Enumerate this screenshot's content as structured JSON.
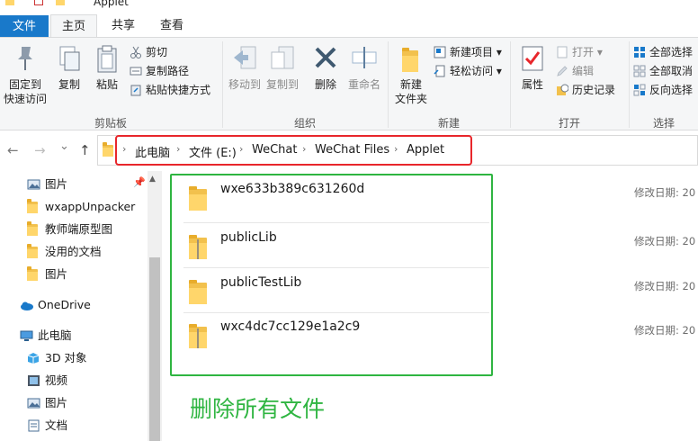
{
  "window": {
    "title": "Applet"
  },
  "tabs": {
    "file": "文件",
    "home": "主页",
    "share": "共享",
    "view": "查看"
  },
  "ribbon": {
    "clipboard": {
      "label": "剪贴板",
      "pin": "固定到\n快速访问",
      "copy": "复制",
      "paste": "粘贴",
      "cut": "剪切",
      "copy_path": "复制路径",
      "paste_shortcut": "粘贴快捷方式"
    },
    "organize": {
      "label": "组织",
      "move_to": "移动到",
      "copy_to": "复制到",
      "delete": "删除",
      "rename": "重命名"
    },
    "new": {
      "label": "新建",
      "new_folder": "新建\n文件夹",
      "new_item": "新建项目 ▾",
      "easy_access": "轻松访问 ▾"
    },
    "open": {
      "label": "打开",
      "properties": "属性",
      "open": "打开 ▾",
      "edit": "编辑",
      "history": "历史记录"
    },
    "select": {
      "label": "选择",
      "select_all": "全部选择",
      "select_none": "全部取消",
      "invert": "反向选择"
    }
  },
  "nav": {
    "back": "←",
    "forward": "→",
    "recent": "⌄",
    "up": "↑"
  },
  "breadcrumb": [
    "此电脑",
    "文件 (E:)",
    "WeChat",
    "WeChat Files",
    "Applet"
  ],
  "sidebar": {
    "items": [
      {
        "label": "图片",
        "pinned": true
      },
      {
        "label": "wxappUnpacker"
      },
      {
        "label": "教师端原型图"
      },
      {
        "label": "没用的文档"
      },
      {
        "label": "图片"
      },
      {
        "label": "OneDrive"
      },
      {
        "label": "此电脑"
      },
      {
        "label": "3D 对象"
      },
      {
        "label": "视频"
      },
      {
        "label": "图片"
      },
      {
        "label": "文档"
      }
    ]
  },
  "files": [
    {
      "name": "wxe633b389c631260d",
      "date_label": "修改日期: 20"
    },
    {
      "name": "publicLib",
      "date_label": "修改日期: 20"
    },
    {
      "name": "publicTestLib",
      "date_label": "修改日期: 20"
    },
    {
      "name": "wxc4dc7cc129e1a2c9",
      "date_label": "修改日期: 20"
    }
  ],
  "annotation": "删除所有文件",
  "colors": {
    "accent": "#1979ca",
    "highlight_red": "#e8262b",
    "highlight_green": "#2fb541",
    "folder": "#f2c14d"
  }
}
